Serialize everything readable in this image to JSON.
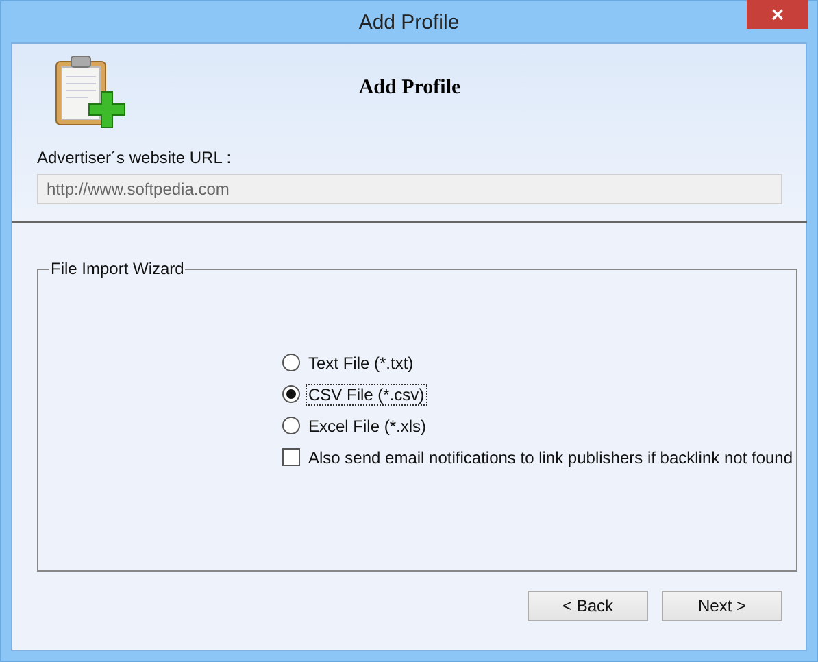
{
  "window": {
    "title": "Add Profile",
    "close": "✕"
  },
  "header": {
    "title": "Add Profile"
  },
  "url": {
    "label": "Advertiser´s website URL :",
    "value": "http://www.softpedia.com",
    "disabled": true
  },
  "group": {
    "title": "File Import Wizard",
    "options": [
      {
        "kind": "radio",
        "label": "Text File (*.txt)",
        "selected": false
      },
      {
        "kind": "radio",
        "label": "CSV File (*.csv)",
        "selected": true
      },
      {
        "kind": "radio",
        "label": "Excel File (*.xls)",
        "selected": false
      },
      {
        "kind": "checkbox",
        "label": "Also send email notifications to link publishers if backlink not found",
        "checked": false
      }
    ]
  },
  "buttons": [
    "< Back",
    "Next >"
  ]
}
